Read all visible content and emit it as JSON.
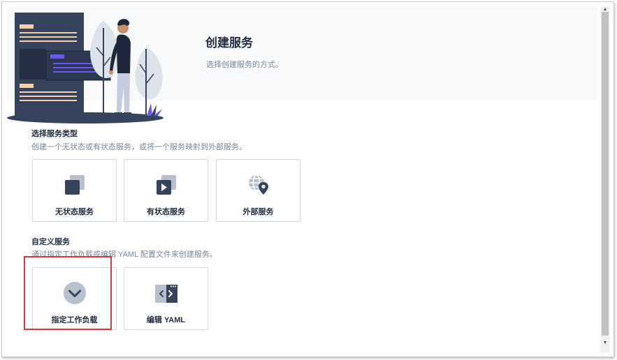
{
  "header": {
    "title": "创建服务",
    "subtitle": "选择创建服务的方式。"
  },
  "service_types": {
    "title": "选择服务类型",
    "description": "创建一个无状态或有状态服务，或将一个服务映射到外部服务。",
    "cards": [
      {
        "label": "无状态服务",
        "icon": "stateless-service-icon"
      },
      {
        "label": "有状态服务",
        "icon": "stateful-service-icon"
      },
      {
        "label": "外部服务",
        "icon": "external-service-icon"
      }
    ]
  },
  "custom_service": {
    "title": "自定义服务",
    "description": "通过指定工作负载或编辑 YAML 配置文件来创建服务。",
    "cards": [
      {
        "label": "指定工作负载",
        "icon": "specify-workload-icon",
        "highlighted": true
      },
      {
        "label": "编辑 YAML",
        "icon": "edit-yaml-icon"
      }
    ]
  },
  "colors": {
    "highlight": "#d63a3a",
    "icon_dark": "#36435c",
    "icon_light": "#b7c0cc",
    "accent_purple": "#6d55f0"
  }
}
